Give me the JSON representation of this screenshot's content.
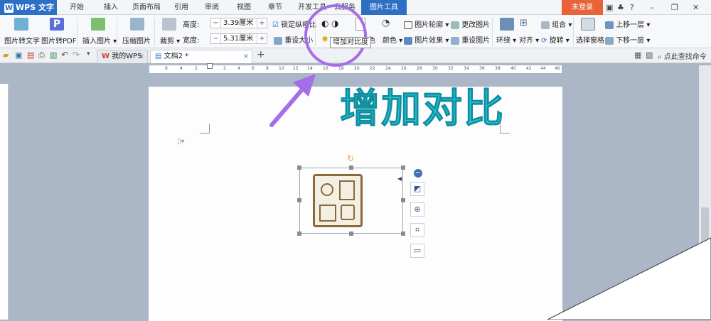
{
  "app": {
    "name": "WPS 文字",
    "logo_letter": "W"
  },
  "menu": {
    "tabs": [
      "开始",
      "插入",
      "页面布局",
      "引用",
      "审阅",
      "视图",
      "章节",
      "开发工具",
      "云服务",
      "图片工具"
    ],
    "active_tab": "图片工具",
    "login": "未登录"
  },
  "ribbon": {
    "img_to_text": "图片转文字",
    "img_to_pdf": "图片转PDF",
    "insert_image": "插入图片",
    "compress_image": "压缩图片",
    "crop": "裁剪",
    "height_label": "高度:",
    "height_value": "3.39厘米",
    "width_label": "宽度:",
    "width_value": "5.31厘米",
    "lock_ratio": "锁定纵横比",
    "reset_size": "重设大小",
    "image_outline": "图片轮廓",
    "change_image": "更改图片",
    "color": "颜色",
    "image_effect": "图片效果",
    "reset_image": "重设图片",
    "color_partial": "色",
    "wrap": "环绕",
    "align": "对齐",
    "group": "组合",
    "rotate": "旋转",
    "selection_pane": "选择窗格",
    "bring_forward": "上移一层",
    "send_backward": "下移一层",
    "minus": "−",
    "plus": "+"
  },
  "tooltip": "增加对比度",
  "annotation": "增加对比",
  "tabs": {
    "wps_home": "我的WPS",
    "document": "文档2 *",
    "add": "+",
    "search_placeholder": "点此查找命令"
  },
  "ruler": [
    "6",
    "4",
    "2",
    "",
    "2",
    "4",
    "6",
    "8",
    "10",
    "12",
    "14",
    "16",
    "18",
    "20",
    "22",
    "24",
    "26",
    "28",
    "30",
    "32",
    "34",
    "36",
    "38",
    "40",
    "42",
    "44",
    "46"
  ],
  "colors": {
    "accent": "#2d6fc4",
    "login": "#e8633a",
    "annotation": "#2bc6d6",
    "circle": "#a56ee8"
  }
}
